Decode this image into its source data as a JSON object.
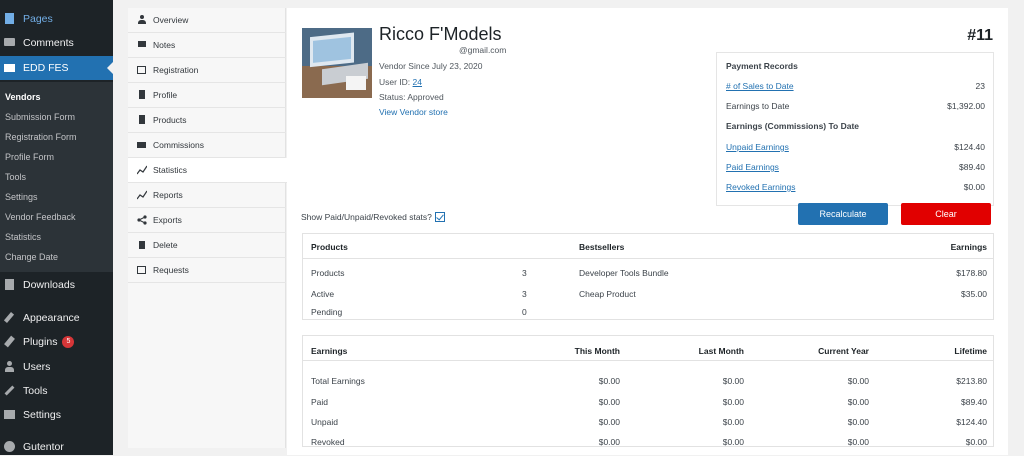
{
  "admin_menu": {
    "pages": "Pages",
    "comments": "Comments",
    "edd_fes": "EDD FES",
    "submenu": [
      {
        "label": "Vendors",
        "active": true
      },
      {
        "label": "Submission Form"
      },
      {
        "label": "Registration Form"
      },
      {
        "label": "Profile Form"
      },
      {
        "label": "Tools"
      },
      {
        "label": "Settings"
      },
      {
        "label": "Vendor Feedback"
      },
      {
        "label": "Statistics"
      },
      {
        "label": "Change Date"
      }
    ],
    "downloads": "Downloads",
    "appearance": "Appearance",
    "plugins": "Plugins",
    "plugins_badge": "5",
    "users": "Users",
    "tools": "Tools",
    "settings": "Settings",
    "gutentor": "Gutentor"
  },
  "vendor_nav": [
    {
      "label": "Overview",
      "icon": "user-icon"
    },
    {
      "label": "Notes",
      "icon": "comment-icon"
    },
    {
      "label": "Registration",
      "icon": "list-icon"
    },
    {
      "label": "Profile",
      "icon": "document-icon"
    },
    {
      "label": "Products",
      "icon": "document-icon"
    },
    {
      "label": "Commissions",
      "icon": "cart-icon"
    },
    {
      "label": "Statistics",
      "icon": "chart-line-icon",
      "active": true
    },
    {
      "label": "Reports",
      "icon": "chart-line-icon"
    },
    {
      "label": "Exports",
      "icon": "share-icon"
    },
    {
      "label": "Delete",
      "icon": "trash-icon"
    },
    {
      "label": "Requests",
      "icon": "inbox-icon"
    }
  ],
  "vendor": {
    "name": "Ricco F'Models",
    "email": "@gmail.com",
    "since": "Vendor Since July 23, 2020",
    "user_id_label": "User ID:",
    "user_id": "24",
    "status": "Status:  Approved",
    "store_link": "View Vendor store",
    "number": "#11"
  },
  "payment_records": {
    "title": "Payment Records",
    "sales_label": "# of Sales to Date",
    "sales_value": "23",
    "earnings_label": "Earnings to Date",
    "earnings_value": "$1,392.00",
    "commissions_title": "Earnings (Commissions) To Date",
    "unpaid_label": "Unpaid Earnings",
    "unpaid_value": "$124.40",
    "paid_label": "Paid Earnings",
    "paid_value": "$89.40",
    "revoked_label": "Revoked Earnings",
    "revoked_value": "$0.00"
  },
  "buttons": {
    "recalculate": "Recalculate",
    "clear": "Clear"
  },
  "show_stats_label": "Show Paid/Unpaid/Revoked stats?",
  "products_box": {
    "headers": {
      "products": "Products",
      "bestsellers": "Bestsellers",
      "earnings": "Earnings"
    },
    "rows": [
      {
        "label": "Products",
        "count": "3",
        "bestseller": "Developer Tools Bundle",
        "earning": "$178.80"
      },
      {
        "label": "Active",
        "count": "3",
        "bestseller": "Cheap Product",
        "earning": "$35.00"
      },
      {
        "label": "Pending",
        "count": "0",
        "bestseller": "",
        "earning": ""
      }
    ]
  },
  "earnings_box": {
    "headers": {
      "earnings": "Earnings",
      "this_month": "This Month",
      "last_month": "Last Month",
      "current_year": "Current Year",
      "lifetime": "Lifetime"
    },
    "rows": [
      {
        "label": "Total Earnings",
        "this_month": "$0.00",
        "last_month": "$0.00",
        "current_year": "$0.00",
        "lifetime": "$213.80"
      },
      {
        "label": "Paid",
        "this_month": "$0.00",
        "last_month": "$0.00",
        "current_year": "$0.00",
        "lifetime": "$89.40"
      },
      {
        "label": "Unpaid",
        "this_month": "$0.00",
        "last_month": "$0.00",
        "current_year": "$0.00",
        "lifetime": "$124.40"
      },
      {
        "label": "Revoked",
        "this_month": "$0.00",
        "last_month": "$0.00",
        "current_year": "$0.00",
        "lifetime": "$0.00"
      }
    ]
  },
  "colors": {
    "accent": "#2271b1",
    "danger": "#e10000",
    "sidebar": "#1d2327"
  }
}
